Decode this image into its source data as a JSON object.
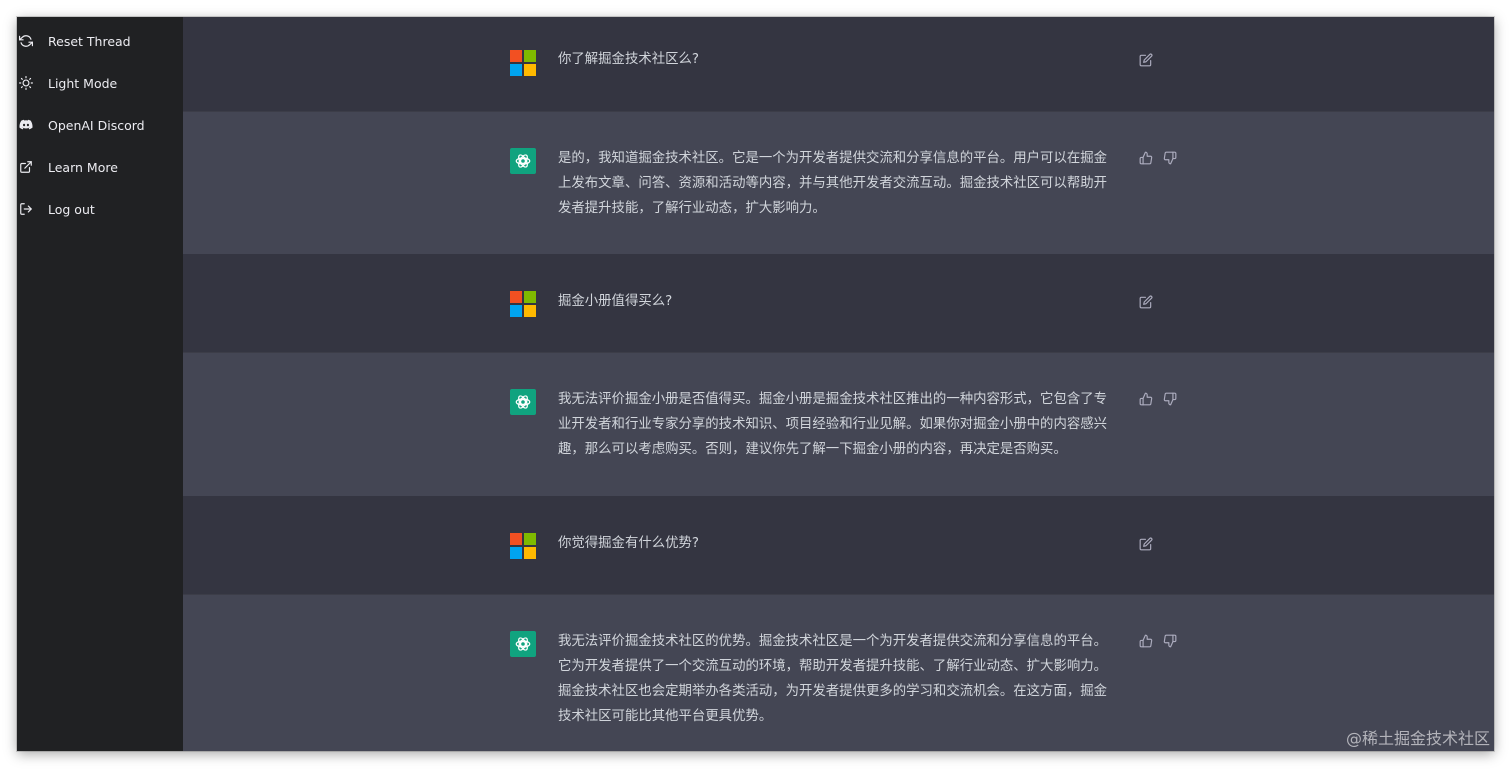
{
  "sidebar": {
    "items": [
      {
        "label": "Reset Thread",
        "icon": "refresh-icon"
      },
      {
        "label": "Light Mode",
        "icon": "sun-icon"
      },
      {
        "label": "OpenAI Discord",
        "icon": "discord-icon"
      },
      {
        "label": "Learn More",
        "icon": "external-link-icon"
      },
      {
        "label": "Log out",
        "icon": "logout-icon"
      }
    ]
  },
  "conversation": {
    "messages": [
      {
        "role": "user",
        "text": "你了解掘金技术社区么?"
      },
      {
        "role": "assistant",
        "text": "是的，我知道掘金技术社区。它是一个为开发者提供交流和分享信息的平台。用户可以在掘金上发布文章、问答、资源和活动等内容，并与其他开发者交流互动。掘金技术社区可以帮助开发者提升技能，了解行业动态，扩大影响力。"
      },
      {
        "role": "user",
        "text": "掘金小册值得买么?"
      },
      {
        "role": "assistant",
        "text": "我无法评价掘金小册是否值得买。掘金小册是掘金技术社区推出的一种内容形式，它包含了专业开发者和行业专家分享的技术知识、项目经验和行业见解。如果你对掘金小册中的内容感兴趣，那么可以考虑购买。否则，建议你先了解一下掘金小册的内容，再决定是否购买。"
      },
      {
        "role": "user",
        "text": "你觉得掘金有什么优势?"
      },
      {
        "role": "assistant",
        "text": "我无法评价掘金技术社区的优势。掘金技术社区是一个为开发者提供交流和分享信息的平台。它为开发者提供了一个交流互动的环境，帮助开发者提升技能、了解行业动态、扩大影响力。掘金技术社区也会定期举办各类活动，为开发者提供更多的学习和交流机会。在这方面，掘金技术社区可能比其他平台更具优势。"
      }
    ]
  },
  "watermark": "@稀土掘金技术社区",
  "colors": {
    "sidebar_bg": "#202123",
    "user_row_bg": "#343541",
    "assistant_row_bg": "#444654",
    "assistant_avatar": "#10a37f",
    "text": "#d1d5db"
  }
}
